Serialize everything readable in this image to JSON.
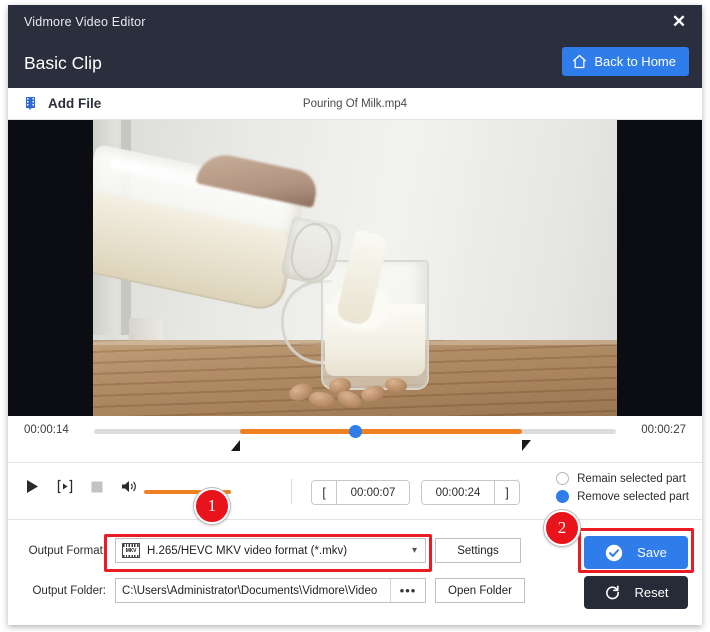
{
  "window": {
    "title": "Vidmore Video Editor",
    "close_icon": "close-icon"
  },
  "header": {
    "title": "Basic Clip",
    "back_home_label": "Back to Home",
    "back_home_icon": "home-icon",
    "accent_blue": "#2e7dea",
    "dark_bg": "#2b2f3d"
  },
  "filebar": {
    "add_file_label": "Add File",
    "add_file_icon": "add-file-icon",
    "current_file": "Pouring Of Milk.mp4"
  },
  "preview": {
    "letterbox_color": "#0b0d13",
    "scene": "milk being poured from a glass bottle into a glass mug with almonds on a wooden table"
  },
  "timeline": {
    "start_time": "00:00:14",
    "end_time": "00:00:27",
    "selection_color": "#f08122",
    "track_color": "#dcdcdc",
    "playhead_color": "#2e7dea",
    "selection_start_pct": 28,
    "selection_end_pct": 82,
    "playhead_pct": 50,
    "left_handle_icon": "trim-handle-left-icon",
    "right_handle_icon": "trim-handle-right-icon"
  },
  "controls": {
    "play_icon": "play-icon",
    "frame_step_icon": "frame-step-icon",
    "stop_icon": "stop-icon",
    "volume_icon": "volume-icon",
    "volume_color": "#f08122",
    "volume_pct": 100,
    "trim_start_tag": "[",
    "trim_start_value": "00:00:07",
    "trim_end_value": "00:00:24",
    "trim_end_tag": "]",
    "radio_options": [
      {
        "label": "Remain selected part",
        "selected": false
      },
      {
        "label": "Remove selected part",
        "selected": true
      }
    ]
  },
  "outputs": {
    "format_label": "Output Format:",
    "format_value": "H.265/HEVC MKV video format (*.mkv)",
    "format_icon": "mkv-format-icon",
    "format_icon_text": "MKV",
    "settings_label": "Settings",
    "folder_label": "Output Folder:",
    "folder_value": "C:\\Users\\Administrator\\Documents\\Vidmore\\Video",
    "browse_label": "•••",
    "open_folder_label": "Open Folder",
    "save_label": "Save",
    "save_icon": "check-circle-icon",
    "reset_label": "Reset",
    "reset_icon": "reset-icon"
  },
  "annotations": {
    "highlight_color": "#ec1c24",
    "badges": [
      {
        "number": "1",
        "target": "volume-slider"
      },
      {
        "number": "2",
        "target": "save-button"
      }
    ]
  }
}
